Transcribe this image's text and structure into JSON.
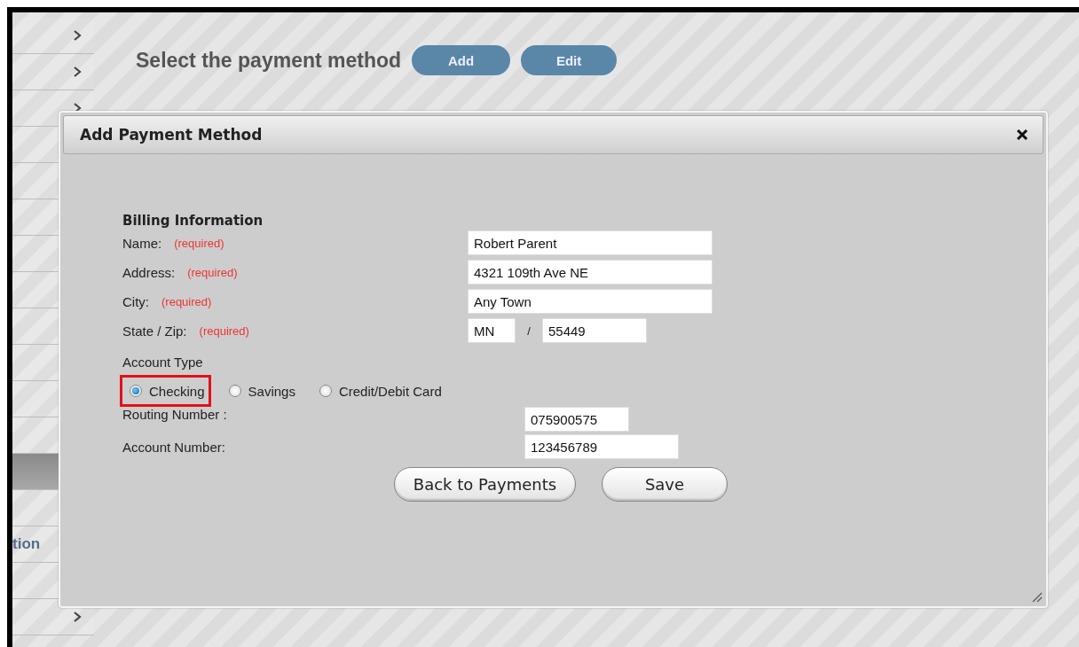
{
  "sidebar": {
    "items": [
      {
        "kind": "link",
        "selected": false
      },
      {
        "kind": "link",
        "selected": false
      },
      {
        "kind": "link",
        "selected": false
      },
      {
        "kind": "plain",
        "selected": false
      },
      {
        "kind": "plain",
        "selected": false
      },
      {
        "kind": "plain",
        "selected": false
      },
      {
        "kind": "plain",
        "selected": false
      },
      {
        "kind": "plain",
        "selected": false
      },
      {
        "kind": "plain",
        "selected": false
      },
      {
        "kind": "plain",
        "selected": false
      },
      {
        "kind": "plain",
        "selected": false
      },
      {
        "kind": "plain",
        "selected": false
      },
      {
        "kind": "plain",
        "selected": true
      },
      {
        "kind": "plain",
        "selected": false
      },
      {
        "kind": "plain",
        "selected": false,
        "label": "tion"
      },
      {
        "kind": "plain",
        "selected": false
      },
      {
        "kind": "link",
        "selected": false
      }
    ]
  },
  "page": {
    "heading": "Select the payment method",
    "buttons": [
      "Add",
      "Edit"
    ]
  },
  "dialog": {
    "title": "Add Payment Method",
    "section_title": "Billing Information",
    "fields": [
      {
        "kind": "single",
        "label": "Name:",
        "note": "(required)",
        "value": "Robert Parent"
      },
      {
        "kind": "single",
        "label": "Address:",
        "note": "(required)",
        "value": "4321 109th Ave NE"
      },
      {
        "kind": "single",
        "label": "City:",
        "note": "(required)",
        "value": "Any Town"
      },
      {
        "kind": "pair",
        "label": "State / Zip:",
        "note": "(required)",
        "value": "MN",
        "separator": "/",
        "value_2": "55449"
      }
    ],
    "account_type": {
      "label": "Account Type",
      "options": [
        {
          "label": "Checking",
          "selected": true,
          "highlighted": true
        },
        {
          "label": "Savings",
          "selected": false,
          "highlighted": false
        },
        {
          "label": "Credit/Debit Card",
          "selected": false,
          "highlighted": false
        }
      ]
    },
    "account_fields": [
      {
        "label": "Routing Number :",
        "value": "075900575",
        "wide": false
      },
      {
        "label": "Account Number:",
        "value": "123456789",
        "wide": true
      }
    ],
    "buttons": [
      "Back to Payments",
      "Save"
    ]
  }
}
